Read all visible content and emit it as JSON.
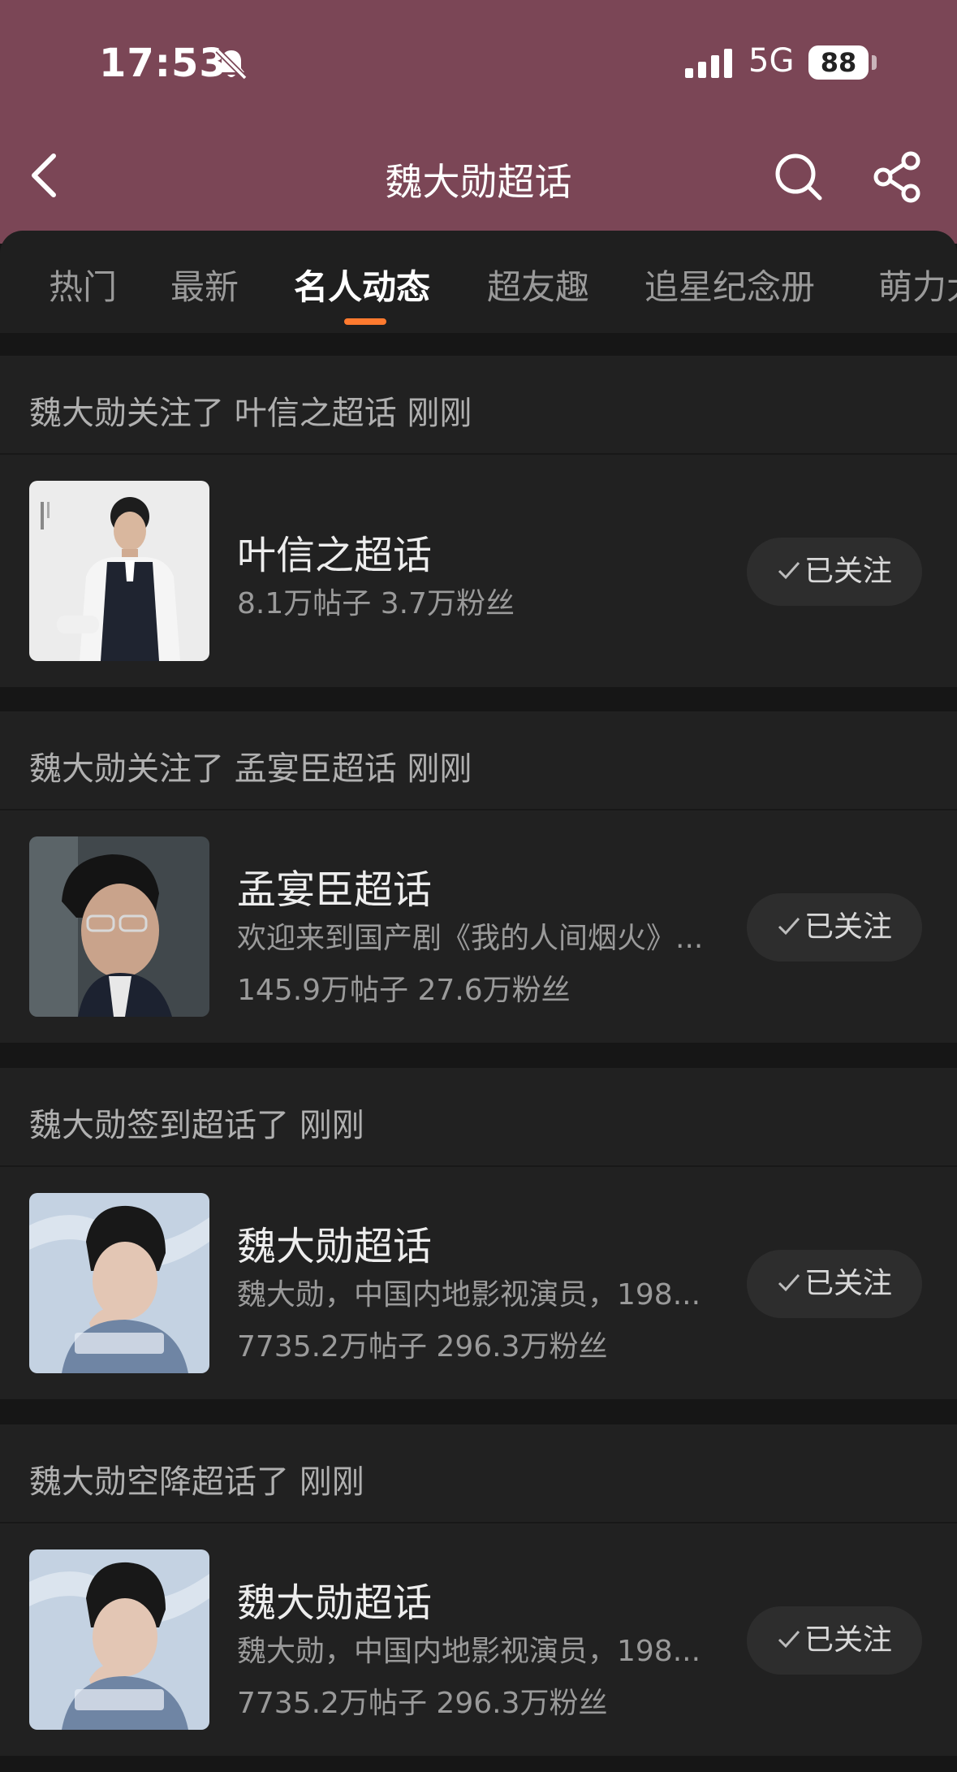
{
  "status_bar": {
    "time": "17:53",
    "network": "5G",
    "battery": "88"
  },
  "nav": {
    "title": "魏大勋超话"
  },
  "tabs": [
    {
      "label": "热门"
    },
    {
      "label": "最新"
    },
    {
      "label": "名人动态"
    },
    {
      "label": "超友趣"
    },
    {
      "label": "追星纪念册"
    },
    {
      "label": "萌力大"
    }
  ],
  "active_tab": "名人动态",
  "feed": [
    {
      "header": "魏大勋关注了 叶信之超话 刚刚",
      "title": "叶信之超话",
      "desc": "",
      "stats": "8.1万帖子  3.7万粉丝",
      "button": "已关注"
    },
    {
      "header": "魏大勋关注了 孟宴臣超话 刚刚",
      "title": "孟宴臣超话",
      "desc": "欢迎来到国产剧《我的人间烟火》...",
      "stats": "145.9万帖子  27.6万粉丝",
      "button": "已关注"
    },
    {
      "header": "魏大勋签到超话了 刚刚",
      "title": "魏大勋超话",
      "desc": "魏大勋，中国内地影视演员，198...",
      "stats": "7735.2万帖子  296.3万粉丝",
      "button": "已关注"
    },
    {
      "header": "魏大勋空降超话了 刚刚",
      "title": "魏大勋超话",
      "desc": "魏大勋，中国内地影视演员，198...",
      "stats": "7735.2万帖子  296.3万粉丝",
      "button": "已关注"
    }
  ],
  "colors": {
    "header_bg": "#7b4656",
    "tab_indicator": "#ff7a2f",
    "card_bg": "#212121"
  }
}
